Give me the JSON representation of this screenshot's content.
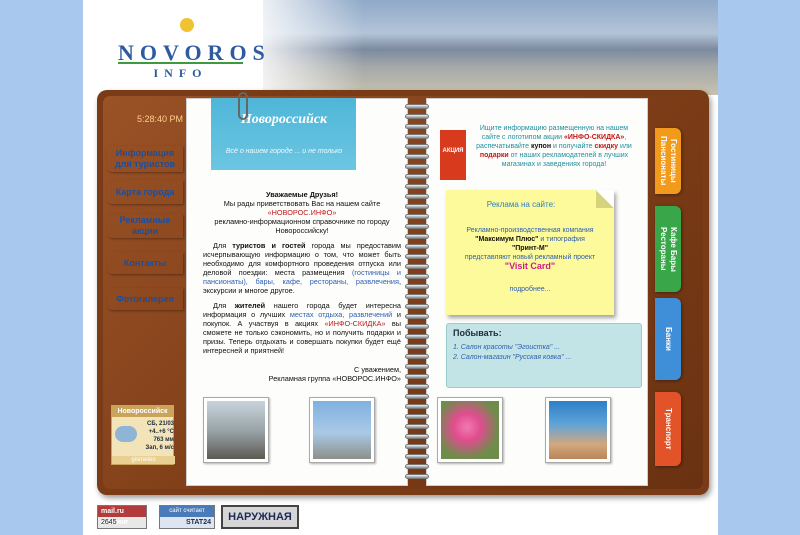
{
  "header": {
    "logo_text": "NOVOROS",
    "logo_sub": "INFO"
  },
  "clock": "5:28:40 PM",
  "left_tabs": [
    {
      "label": "Информация для туристов",
      "color": "#9ed3f0"
    },
    {
      "label": "Карта города",
      "color": "#f5e86a"
    },
    {
      "label": "Рекламные акции",
      "color": "#b4c7ea"
    },
    {
      "label": "Контакты",
      "color": "#f7c1a0"
    },
    {
      "label": "Фотогалерея",
      "color": "#b7e4ef"
    }
  ],
  "left_page": {
    "card_title": "Новороссийск",
    "card_subtitle": "Всё о нашем городе ... и не только",
    "greeting_title": "Уважаемые Друзья!",
    "greeting_line1": "Мы рады приветствовать Вас на нашем сайте",
    "site_name": "«НОВОРОС.ИНФО»",
    "greeting_line2": "рекламно-информационном справочнике по городу Новороссийску!",
    "p1_start": "Для",
    "p1_bold": "туристов и гостей",
    "p1_mid": "города мы предоставим исчерпывающую информацию о том, что может быть необходимо для комфортного проведения отпуска или деловой поездки: места размещения",
    "p1_links": "(гостиницы и пансионаты), бары, кафе, рестораны, развлечения",
    "p1_end": ", экскурсии и многое другое.",
    "p2_start": "Для",
    "p2_bold": "жителей",
    "p2_mid": "нашего города будет интересна информация о лучших",
    "p2_links": "местах отдыха, развлечений",
    "p2_mid2": "и покупок. А участвуя в акциях",
    "p2_red": "«ИНФО-СКИДКА»",
    "p2_end": "вы сможете не только сэкономить, но и получить подарки и призы. Теперь отдыхать и совершать покупки будет ещё интересней и приятней!",
    "sign1": "С уважением,",
    "sign2": "Рекламная группа «НОВОРОС.ИНФО»"
  },
  "right_page": {
    "promo_badge": "АКЦИЯ",
    "promo_text1": "Ищите информацию размещенную на нашем сайте с логотипом акции",
    "promo_red": "«ИНФО-СКИДКА»",
    "promo_text2": ", распечатывайте",
    "promo_bold1": "купон",
    "promo_text3": "и получайте",
    "promo_bold2": "скидку",
    "promo_text4": "или",
    "promo_bold3": "подарки",
    "promo_text5": "от наших рекламодателей в лучших магазинах и заведениях города!",
    "sticky_title": "Реклама на сайте:",
    "sticky_line1": "Рекламно-производственная компания",
    "sticky_b1": "\"Максимум Плюс\"",
    "sticky_line2": "и типография",
    "sticky_b2": "\"Принт-М\"",
    "sticky_line3": "представляют новый рекламный проект",
    "sticky_visit": "\"Visit Card\"",
    "sticky_more": "подробнее...",
    "news_title": "Побывать:",
    "news_items": [
      "1. Салон красоты \"Эгоистка\" ...",
      "2. Салон-магазин \"Русская ковка\" ..."
    ]
  },
  "right_tabs": [
    {
      "label": "Гостиницы Пансионаты",
      "color": "#f19a1c"
    },
    {
      "label": "Кафе Бары Рестораны",
      "color": "#3aa64a"
    },
    {
      "label": "Банки",
      "color": "#3f8fd8"
    },
    {
      "label": "Транспорт",
      "color": "#e2532a"
    }
  ],
  "weather": {
    "city": "Новороссийск",
    "date": "СБ, 21/03",
    "temp": "+4..+6 °C",
    "pressure": "763 мм",
    "wind": "Зап, 6 м/с",
    "source": "gismeteo"
  },
  "counters": {
    "mail_label": "mail.ru рейтинг",
    "mail_value": "2645",
    "stat_label": "сайт считает",
    "stat_value": "STAT24",
    "outdoor": "НАРУЖНАЯ"
  }
}
